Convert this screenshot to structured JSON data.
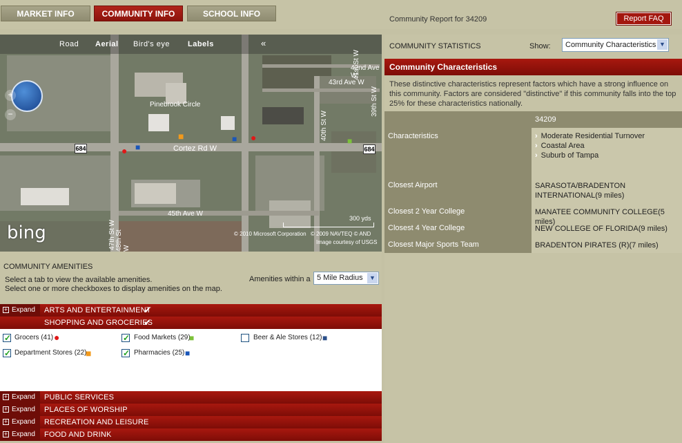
{
  "tabs": {
    "market": "MARKET INFO",
    "community": "COMMUNITY INFO",
    "school": "SCHOOL INFO"
  },
  "report_title": "Community Report for 34209",
  "report_faq": "Report FAQ",
  "map": {
    "views": [
      "Road",
      "Aerial",
      "Bird's eye",
      "Labels"
    ],
    "collapse": "«",
    "streets": {
      "pinebrook": "Pinebrook Circle",
      "cortez": "Cortez Rd W",
      "ave43": "43rd Ave W",
      "ave42": "42nd Ave W",
      "ave45": "45th Ave W",
      "st41": "41st St W",
      "st40": "40th St W",
      "st39": "39th St W",
      "st47": "47th St W",
      "st48": "48th St W"
    },
    "route": "684",
    "scale": "300 yds",
    "copyright1": "© 2010 Microsoft Corporation",
    "copyright2": "© 2009 NAVTEQ   © AND",
    "copyright3": "Image courtesy of USGS",
    "logo": "bing",
    "zoom_in": "+",
    "zoom_out": "−"
  },
  "amenities": {
    "title": "COMMUNITY AMENITIES",
    "line1": "Select a tab to view the available amenities.",
    "line2": "Select one or more checkboxes to display amenities on the map.",
    "within_label": "Amenities within a",
    "radius": "5 Mile Radius",
    "expand_label": "Expand",
    "categories_top": [
      {
        "label": "ARTS AND ENTERTAINMENT",
        "checked": true
      },
      {
        "label": "SHOPPING AND GROCERIES",
        "checked": true
      }
    ],
    "shopping_items": [
      {
        "label": "Grocers (41)",
        "checked": true
      },
      {
        "label": "Food Markets (29)",
        "checked": true
      },
      {
        "label": "Beer & Ale Stores (12)",
        "checked": false
      },
      {
        "label": "Department Stores (22)",
        "checked": true
      },
      {
        "label": "Pharmacies (25)",
        "checked": true
      }
    ],
    "categories_bottom": [
      {
        "label": "PUBLIC SERVICES"
      },
      {
        "label": "PLACES OF WORSHIP"
      },
      {
        "label": "RECREATION AND LEISURE"
      },
      {
        "label": "FOOD AND DRINK"
      }
    ]
  },
  "stats": {
    "title": "COMMUNITY STATISTICS",
    "show_label": "Show:",
    "show_value": "Community Characteristics",
    "section_title": "Community Characteristics",
    "description": "These distinctive characteristics represent factors which have a strong influence on this community. Factors are considered \"distinctive\" if this community falls into the top 25% for these characteristics nationally.",
    "zip": "34209",
    "rows": {
      "characteristics_label": "Characteristics",
      "characteristics": [
        "Moderate Residential Turnover",
        "Coastal Area",
        "Suburb of Tampa"
      ],
      "airport_label": "Closest Airport",
      "airport": "SARASOTA/BRADENTON INTERNATIONAL(9 miles)",
      "college2_label": "Closest 2 Year College",
      "college2": "MANATEE COMMUNITY COLLEGE(5 miles)",
      "college4_label": "Closest 4 Year College",
      "college4": "NEW COLLEGE OF FLORIDA(9 miles)",
      "sports_label": "Closest Major Sports Team",
      "sports": "BRADENTON PIRATES (R)(7 miles)"
    }
  }
}
